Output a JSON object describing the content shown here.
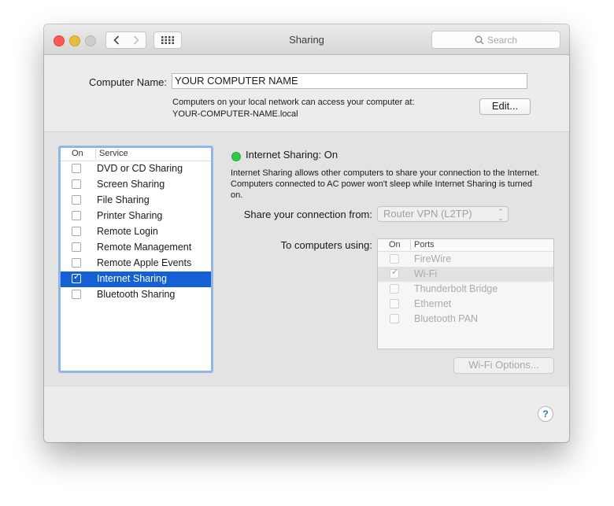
{
  "window": {
    "title": "Sharing"
  },
  "toolbar": {
    "search_placeholder": "Search"
  },
  "computer": {
    "label": "Computer Name:",
    "value": "YOUR COMPUTER NAME",
    "info_line1": "Computers on your local network can access your computer at:",
    "info_line2": "YOUR-COMPUTER-NAME.local",
    "edit_label": "Edit..."
  },
  "services": {
    "header_on": "On",
    "header_service": "Service",
    "items": [
      {
        "label": "DVD or CD Sharing",
        "checked": false,
        "selected": false
      },
      {
        "label": "Screen Sharing",
        "checked": false,
        "selected": false
      },
      {
        "label": "File Sharing",
        "checked": false,
        "selected": false
      },
      {
        "label": "Printer Sharing",
        "checked": false,
        "selected": false
      },
      {
        "label": "Remote Login",
        "checked": false,
        "selected": false
      },
      {
        "label": "Remote Management",
        "checked": false,
        "selected": false
      },
      {
        "label": "Remote Apple Events",
        "checked": false,
        "selected": false
      },
      {
        "label": "Internet Sharing",
        "checked": true,
        "selected": true
      },
      {
        "label": "Bluetooth Sharing",
        "checked": false,
        "selected": false
      }
    ]
  },
  "detail": {
    "status": "Internet Sharing: On",
    "status_color": "#2ecb46",
    "description": "Internet Sharing allows other computers to share your connection to the Internet. Computers connected to AC power won't sleep while Internet Sharing is turned on.",
    "share_from_label": "Share your connection from:",
    "share_from_value": "Router VPN (L2TP)",
    "to_computers_label": "To computers using:",
    "ports_header_on": "On",
    "ports_header_ports": "Ports",
    "ports": [
      {
        "label": "FireWire",
        "checked": false
      },
      {
        "label": "Wi-Fi",
        "checked": true
      },
      {
        "label": "Thunderbolt Bridge",
        "checked": false
      },
      {
        "label": "Ethernet",
        "checked": false
      },
      {
        "label": "Bluetooth PAN",
        "checked": false
      }
    ],
    "wifi_options_label": "Wi-Fi Options..."
  },
  "help": {
    "label": "?"
  },
  "colors": {
    "selection": "#1560d5",
    "list_border": "#8fb6e6",
    "help_blue": "#2772d8"
  }
}
